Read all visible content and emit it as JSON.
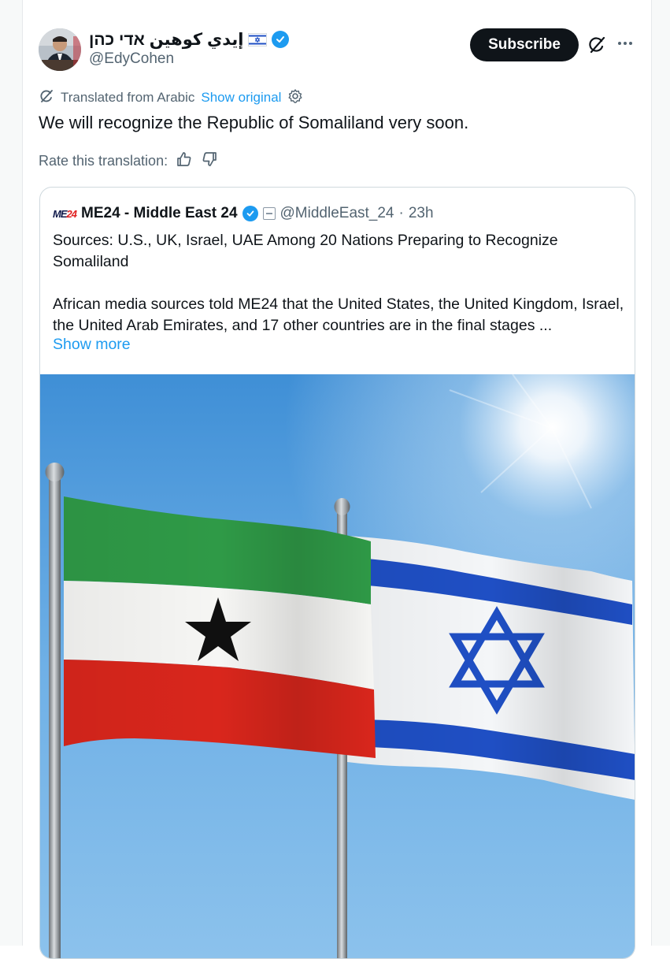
{
  "post": {
    "author_name": "إيدي كوهين אדי כהן",
    "author_handle": "@EdyCohen",
    "subscribe_label": "Subscribe",
    "translated_from": "Translated from Arabic",
    "show_original": "Show original",
    "text": "We will recognize the Republic of Somaliland very soon.",
    "rate_label": "Rate this translation:"
  },
  "quote": {
    "logo_text": "ME",
    "logo_num": "24",
    "name": "ME24 - Middle East 24",
    "handle": "@MiddleEast_24",
    "separator": "·",
    "time": "23h",
    "title": "Sources: U.S., UK, Israel, UAE Among 20 Nations Preparing to Recognize Somaliland",
    "body": "African media sources told ME24 that the United States, the United Kingdom, Israel, the United Arab Emirates, and 17 other countries are in the final stages ...",
    "show_more": "Show more"
  },
  "colors": {
    "accent": "#1d9bf0",
    "text": "#0f1419",
    "muted": "#536471",
    "somaliland_green": "#2f9a47",
    "somaliland_red": "#d9261c",
    "israel_blue": "#1f4fc4"
  },
  "icons": [
    "verified-badge-icon",
    "israel-flag-icon",
    "grok-icon",
    "more-icon",
    "translate-icon",
    "gear-icon",
    "thumbs-up-icon",
    "thumbs-down-icon",
    "government-badge-icon"
  ]
}
